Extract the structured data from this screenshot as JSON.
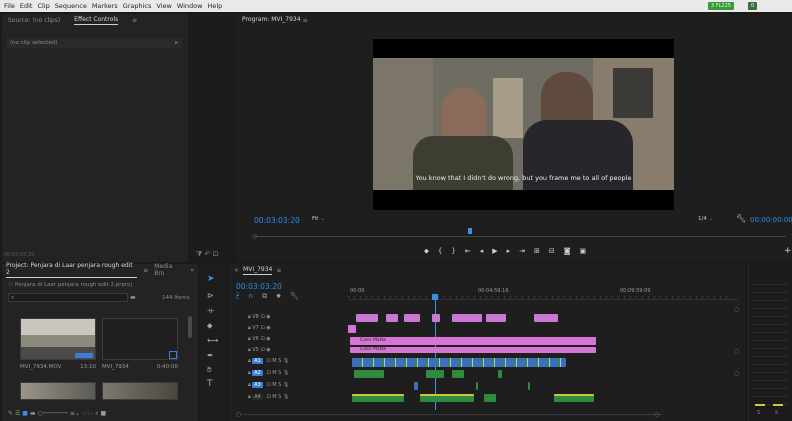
{
  "menu": [
    "File",
    "Edit",
    "Clip",
    "Sequence",
    "Markers",
    "Graphics",
    "View",
    "Window",
    "Help"
  ],
  "top_right": {
    "btn1": "3 FL225",
    "btn2": "0"
  },
  "source_panel": {
    "tab_source": "Source: (no clips)",
    "tab_effect": "Effect Controls",
    "no_clip": "(no clip selected)",
    "timecode": "00:03:03:20"
  },
  "program_panel": {
    "title": "Program: MVI_7934",
    "subtitle": "You know that I didn't do wrong, but you frame me to all of people",
    "timecode": "00:03:03:20",
    "fit": "Fit",
    "ratio": "1/4",
    "duration": "00:00:00:00"
  },
  "project_panel": {
    "tab": "Project: Penjara di Laar penjara rough edit 2",
    "tab2": "Media Bro",
    "project_file": "Penjara di Laar penjara rough edit 2.prproj",
    "items_count": "144 Items",
    "items": [
      {
        "name": "MVI_7934.MOV",
        "duration": "13:10"
      },
      {
        "name": "MVI_7934",
        "duration": "0:40:00"
      }
    ]
  },
  "timeline": {
    "tab": "MVI_7934",
    "timecode": "00:03:03:20",
    "ruler": [
      "00:00",
      "00:04:59:16",
      "00:09:59:09"
    ],
    "video_tracks": [
      "V8",
      "V7",
      "V6",
      "V5"
    ],
    "audio_tracks": [
      "A1",
      "A2",
      "A3",
      "A4"
    ],
    "clip_labels": [
      "Color Matte",
      "Color Matte"
    ]
  },
  "colors": {
    "accent": "#2d8ceb",
    "video_clip": "#c979d1",
    "audio_clip": "#2f8c3f",
    "playhead": "#3a8fe6"
  }
}
